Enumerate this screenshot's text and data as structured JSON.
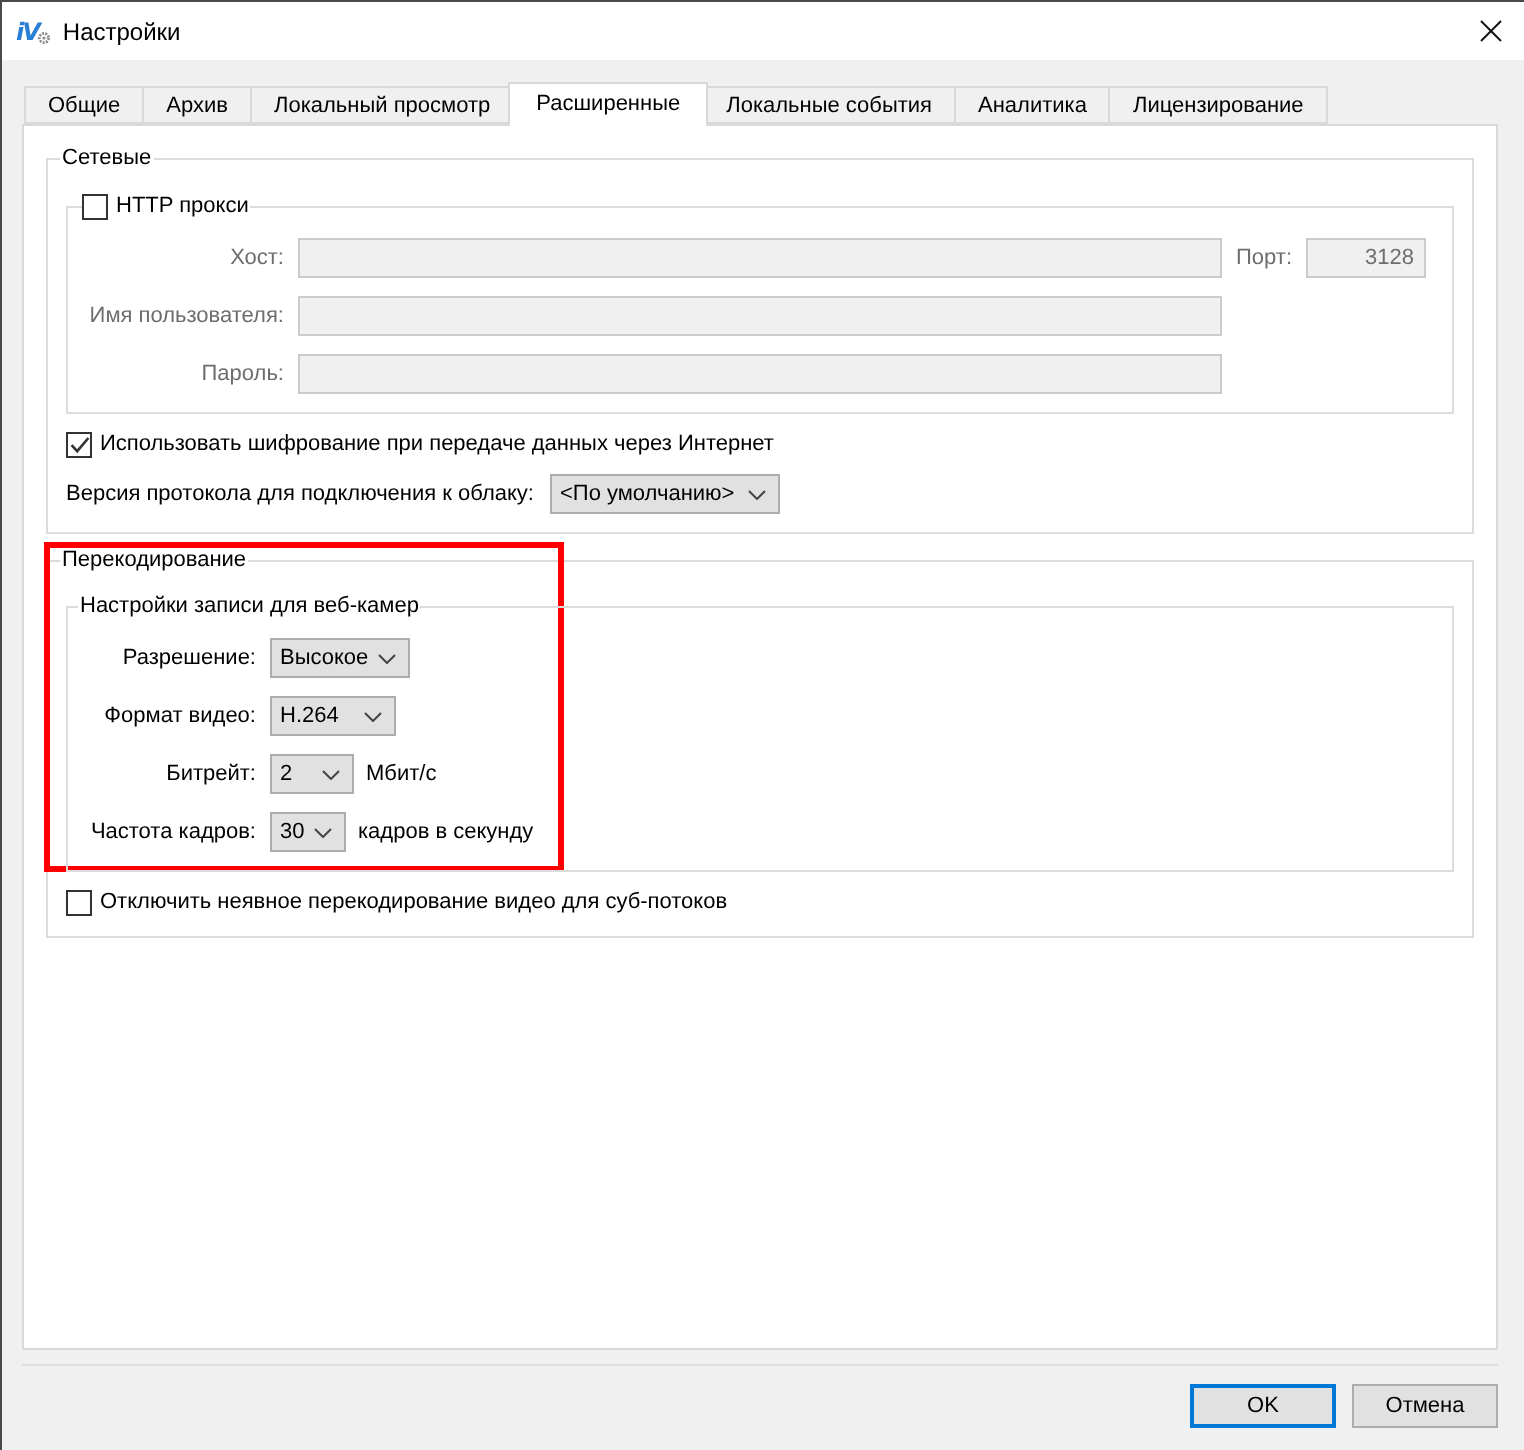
{
  "window": {
    "logo": "iV",
    "title": "Настройки"
  },
  "tabs": [
    {
      "label": "Общие",
      "selected": false
    },
    {
      "label": "Архив",
      "selected": false
    },
    {
      "label": "Локальный просмотр",
      "selected": false
    },
    {
      "label": "Расширенные",
      "selected": true
    },
    {
      "label": "Локальные события",
      "selected": false
    },
    {
      "label": "Аналитика",
      "selected": false
    },
    {
      "label": "Лицензирование",
      "selected": false
    }
  ],
  "network": {
    "title": "Сетевые",
    "http_proxy": {
      "label": "HTTP прокси",
      "checked": false,
      "fields": [
        {
          "label": "Хост:"
        },
        {
          "label": "Имя пользователя:"
        },
        {
          "label": "Пароль:"
        }
      ],
      "port": {
        "label": "Порт:",
        "value": "3128"
      }
    },
    "encryption": {
      "label": "Использовать шифрование при передаче данных через Интернет",
      "checked": true
    },
    "protocol": {
      "label": "Версия протокола для подключения к облаку:",
      "value": "<По умолчанию>"
    }
  },
  "transcoding": {
    "title": "Перекодирование",
    "highlighted": true,
    "webcam": {
      "title": "Настройки записи для веб-камер",
      "rows": [
        {
          "label": "Разрешение:",
          "value": "Высокое"
        },
        {
          "label": "Формат видео:",
          "value": "H.264"
        },
        {
          "label": "Битрейт:",
          "value": "2",
          "unit": "Мбит/с"
        },
        {
          "label": "Частота кадров:",
          "value": "30",
          "unit": "кадров в секунду"
        }
      ]
    },
    "disable_implicit": {
      "label": "Отключить неявное перекодирование видео для суб-потоков",
      "checked": false
    }
  },
  "buttons": [
    {
      "label": "OK",
      "default": true
    },
    {
      "label": "Отмена",
      "default": false
    }
  ]
}
